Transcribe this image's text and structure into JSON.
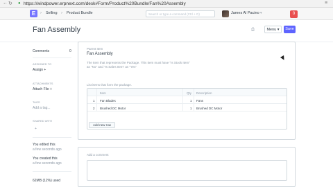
{
  "browser": {
    "url": "https://windpower.erpnext.com/desk#Form/Product%20Bundle/Fan%20Assembly"
  },
  "navbar": {
    "logo": "E",
    "breadcrumb": [
      "Selling",
      "Product Bundle"
    ],
    "search_placeholder": "Search or type a command (Ctrl + G)",
    "user_name": "James Al Pacino",
    "notification_count": "0"
  },
  "page": {
    "title": "Fan Assembly",
    "menu_label": "Menu",
    "save_label": "Save"
  },
  "sidebar": {
    "comments_label": "Comments",
    "comments_count": "0",
    "assigned_to_label": "ASSIGNED TO",
    "assign_label": "Assign",
    "attachments_label": "ATTACHMENTS",
    "attach_label": "Attach File",
    "tags_label": "TAGS",
    "add_tag_label": "Add a tag...",
    "shared_with_label": "SHARED WITH",
    "share_add": "+",
    "edited_text": "You edited this",
    "edited_time": "a few seconds ago",
    "created_text": "You created this",
    "created_time": "a few seconds ago",
    "storage": "62MB (12%) used"
  },
  "form": {
    "parent_item_label": "Parent Item",
    "parent_item_value": "Fan Assembly",
    "parent_item_desc": "The Item that represents the Package. This Item must have \"Is Stock Item\" as \"No\" and \"Is Sales Item\" as \"Yes\"",
    "items_label": "List items that form the package.",
    "columns": {
      "item": "Item",
      "qty": "Qty",
      "description": "Description"
    },
    "rows": [
      {
        "idx": "1",
        "item": "Fan Blades",
        "qty": "1",
        "description": "Fans"
      },
      {
        "idx": "2",
        "item": "Brushed DC Motor",
        "qty": "1",
        "description": "Brushed DC Motor"
      }
    ],
    "add_row_label": "Add new row"
  },
  "comments": {
    "placeholder": "Add a comment"
  }
}
